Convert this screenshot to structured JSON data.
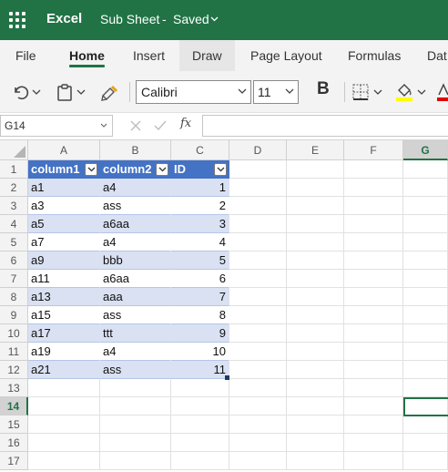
{
  "titlebar": {
    "app_name": "Excel",
    "doc_name": "Sub Sheet",
    "separator": "-",
    "status": "Saved",
    "bg_color": "#217346"
  },
  "ribbon": {
    "tabs": [
      "File",
      "Home",
      "Insert",
      "Draw",
      "Page Layout",
      "Formulas",
      "Dat"
    ],
    "active_tab": "Home"
  },
  "toolbar": {
    "font_name": "Calibri",
    "font_size": "11",
    "bold_label": "B"
  },
  "formula_bar": {
    "name_box": "G14",
    "fx_label": "fx",
    "formula": ""
  },
  "grid": {
    "columns": [
      "A",
      "B",
      "C",
      "D",
      "E",
      "F",
      "G"
    ],
    "rows": [
      "1",
      "2",
      "3",
      "4",
      "5",
      "6",
      "7",
      "8",
      "9",
      "10",
      "11",
      "12",
      "13",
      "14",
      "15",
      "16",
      "17"
    ],
    "selected_column": "G",
    "selected_row": "14",
    "active_cell": "G14"
  },
  "table": {
    "headers": [
      "column1",
      "column2",
      "ID"
    ],
    "rows": [
      [
        "a1",
        "a4",
        "1"
      ],
      [
        "a3",
        "ass",
        "2"
      ],
      [
        "a5",
        "a6aa",
        "3"
      ],
      [
        "a7",
        "a4",
        "4"
      ],
      [
        "a9",
        "bbb",
        "5"
      ],
      [
        "a11",
        "a6aa",
        "6"
      ],
      [
        "a13",
        "aaa",
        "7"
      ],
      [
        "a15",
        "ass",
        "8"
      ],
      [
        "a17",
        "ttt",
        "9"
      ],
      [
        "a19",
        "a4",
        "10"
      ],
      [
        "a21",
        "ass",
        "11"
      ]
    ],
    "header_color": "#4472c4",
    "band_color": "#d9e1f2"
  }
}
